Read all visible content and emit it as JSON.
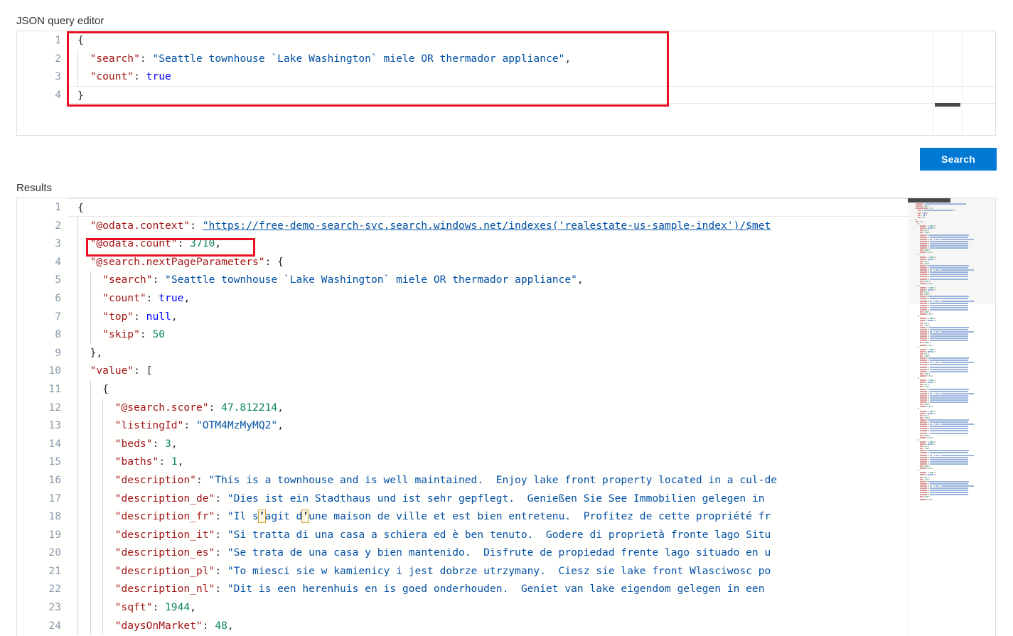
{
  "labels": {
    "query_editor": "JSON query editor",
    "results": "Results"
  },
  "toolbar": {
    "search_label": "Search",
    "accent_color": "#0078d4"
  },
  "annotations": {
    "highlight_color": "#e81123",
    "boxes": [
      {
        "name": "query-body-highlight",
        "target": "json-query-editor-lines-1-4"
      },
      {
        "name": "odata-count-highlight",
        "target": "results-line-3"
      }
    ]
  },
  "query_editor": {
    "language": "json",
    "current_line": 4,
    "lines": [
      {
        "num": "1",
        "tokens": [
          {
            "t": "br",
            "v": "{"
          }
        ]
      },
      {
        "num": "2",
        "indent": 1,
        "tokens": [
          {
            "t": "k",
            "v": "\"search\""
          },
          {
            "t": "p",
            "v": ": "
          },
          {
            "t": "s",
            "v": "\"Seattle townhouse `Lake Washington` miele OR thermador appliance\""
          },
          {
            "t": "p",
            "v": ","
          }
        ]
      },
      {
        "num": "3",
        "indent": 1,
        "tokens": [
          {
            "t": "k",
            "v": "\"count\""
          },
          {
            "t": "p",
            "v": ": "
          },
          {
            "t": "b",
            "v": "true"
          }
        ]
      },
      {
        "num": "4",
        "tokens": [
          {
            "t": "br",
            "v": "}"
          }
        ]
      }
    ]
  },
  "results_editor": {
    "language": "json",
    "current_line": 1,
    "lines": [
      {
        "num": "1",
        "tokens": [
          {
            "t": "br",
            "v": "{"
          }
        ]
      },
      {
        "num": "2",
        "indent": 1,
        "tokens": [
          {
            "t": "k",
            "v": "\"@odata.context\""
          },
          {
            "t": "p",
            "v": ": "
          },
          {
            "t": "url",
            "v": "\"https://free-demo-search-svc.search.windows.net/indexes('realestate-us-sample-index')/$met"
          }
        ]
      },
      {
        "num": "3",
        "indent": 1,
        "tokens": [
          {
            "t": "k",
            "v": "\"@odata.count\""
          },
          {
            "t": "p",
            "v": ": "
          },
          {
            "t": "n",
            "v": "3710"
          },
          {
            "t": "p",
            "v": ","
          }
        ]
      },
      {
        "num": "4",
        "indent": 1,
        "tokens": [
          {
            "t": "k",
            "v": "\"@search.nextPageParameters\""
          },
          {
            "t": "p",
            "v": ": "
          },
          {
            "t": "br",
            "v": "{"
          }
        ]
      },
      {
        "num": "5",
        "indent": 2,
        "tokens": [
          {
            "t": "k",
            "v": "\"search\""
          },
          {
            "t": "p",
            "v": ": "
          },
          {
            "t": "s",
            "v": "\"Seattle townhouse `Lake Washington` miele OR thermador appliance\""
          },
          {
            "t": "p",
            "v": ","
          }
        ]
      },
      {
        "num": "6",
        "indent": 2,
        "tokens": [
          {
            "t": "k",
            "v": "\"count\""
          },
          {
            "t": "p",
            "v": ": "
          },
          {
            "t": "b",
            "v": "true"
          },
          {
            "t": "p",
            "v": ","
          }
        ]
      },
      {
        "num": "7",
        "indent": 2,
        "tokens": [
          {
            "t": "k",
            "v": "\"top\""
          },
          {
            "t": "p",
            "v": ": "
          },
          {
            "t": "b",
            "v": "null"
          },
          {
            "t": "p",
            "v": ","
          }
        ]
      },
      {
        "num": "8",
        "indent": 2,
        "tokens": [
          {
            "t": "k",
            "v": "\"skip\""
          },
          {
            "t": "p",
            "v": ": "
          },
          {
            "t": "n",
            "v": "50"
          }
        ]
      },
      {
        "num": "9",
        "indent": 1,
        "tokens": [
          {
            "t": "br",
            "v": "},"
          }
        ]
      },
      {
        "num": "10",
        "indent": 1,
        "tokens": [
          {
            "t": "k",
            "v": "\"value\""
          },
          {
            "t": "p",
            "v": ": "
          },
          {
            "t": "br",
            "v": "["
          }
        ]
      },
      {
        "num": "11",
        "indent": 2,
        "tokens": [
          {
            "t": "br",
            "v": "{"
          }
        ]
      },
      {
        "num": "12",
        "indent": 3,
        "tokens": [
          {
            "t": "k",
            "v": "\"@search.score\""
          },
          {
            "t": "p",
            "v": ": "
          },
          {
            "t": "n",
            "v": "47.812214"
          },
          {
            "t": "p",
            "v": ","
          }
        ]
      },
      {
        "num": "13",
        "indent": 3,
        "tokens": [
          {
            "t": "k",
            "v": "\"listingId\""
          },
          {
            "t": "p",
            "v": ": "
          },
          {
            "t": "s",
            "v": "\"OTM4MzMyMQ2\""
          },
          {
            "t": "p",
            "v": ","
          }
        ]
      },
      {
        "num": "14",
        "indent": 3,
        "tokens": [
          {
            "t": "k",
            "v": "\"beds\""
          },
          {
            "t": "p",
            "v": ": "
          },
          {
            "t": "n",
            "v": "3"
          },
          {
            "t": "p",
            "v": ","
          }
        ]
      },
      {
        "num": "15",
        "indent": 3,
        "tokens": [
          {
            "t": "k",
            "v": "\"baths\""
          },
          {
            "t": "p",
            "v": ": "
          },
          {
            "t": "n",
            "v": "1"
          },
          {
            "t": "p",
            "v": ","
          }
        ]
      },
      {
        "num": "16",
        "indent": 3,
        "tokens": [
          {
            "t": "k",
            "v": "\"description\""
          },
          {
            "t": "p",
            "v": ": "
          },
          {
            "t": "s",
            "v": "\"This is a townhouse and is well maintained.  Enjoy lake front property located in a cul-de"
          }
        ]
      },
      {
        "num": "17",
        "indent": 3,
        "tokens": [
          {
            "t": "k",
            "v": "\"description_de\""
          },
          {
            "t": "p",
            "v": ": "
          },
          {
            "t": "s",
            "v": "\"Dies ist ein Stadthaus und ist sehr gepflegt.  Genießen Sie See Immobilien gelegen in "
          }
        ]
      },
      {
        "num": "18",
        "indent": 3,
        "tokens": [
          {
            "t": "k",
            "v": "\"description_fr\""
          },
          {
            "t": "p",
            "v": ": "
          },
          {
            "t": "s",
            "v": "\"Il s"
          },
          {
            "t": "uni",
            "v": "’"
          },
          {
            "t": "s",
            "v": "agit d"
          },
          {
            "t": "uni",
            "v": "’"
          },
          {
            "t": "s",
            "v": "une maison de ville et est bien entretenu.  Profitez de cette propriété fr"
          }
        ]
      },
      {
        "num": "19",
        "indent": 3,
        "tokens": [
          {
            "t": "k",
            "v": "\"description_it\""
          },
          {
            "t": "p",
            "v": ": "
          },
          {
            "t": "s",
            "v": "\"Si tratta di una casa a schiera ed è ben tenuto.  Godere di proprietà fronte lago Situ"
          }
        ]
      },
      {
        "num": "20",
        "indent": 3,
        "tokens": [
          {
            "t": "k",
            "v": "\"description_es\""
          },
          {
            "t": "p",
            "v": ": "
          },
          {
            "t": "s",
            "v": "\"Se trata de una casa y bien mantenido.  Disfrute de propiedad frente lago situado en u"
          }
        ]
      },
      {
        "num": "21",
        "indent": 3,
        "tokens": [
          {
            "t": "k",
            "v": "\"description_pl\""
          },
          {
            "t": "p",
            "v": ": "
          },
          {
            "t": "s",
            "v": "\"To miesci sie w kamienicy i jest dobrze utrzymany.  Ciesz sie lake front Wlasciwosc po"
          }
        ]
      },
      {
        "num": "22",
        "indent": 3,
        "tokens": [
          {
            "t": "k",
            "v": "\"description_nl\""
          },
          {
            "t": "p",
            "v": ": "
          },
          {
            "t": "s",
            "v": "\"Dit is een herenhuis en is goed onderhouden.  Geniet van lake eigendom gelegen in een "
          }
        ]
      },
      {
        "num": "23",
        "indent": 3,
        "tokens": [
          {
            "t": "k",
            "v": "\"sqft\""
          },
          {
            "t": "p",
            "v": ": "
          },
          {
            "t": "n",
            "v": "1944"
          },
          {
            "t": "p",
            "v": ","
          }
        ]
      },
      {
        "num": "24",
        "indent": 3,
        "tokens": [
          {
            "t": "k",
            "v": "\"daysOnMarket\""
          },
          {
            "t": "p",
            "v": ": "
          },
          {
            "t": "n",
            "v": "48"
          },
          {
            "t": "p",
            "v": ","
          }
        ]
      }
    ]
  }
}
